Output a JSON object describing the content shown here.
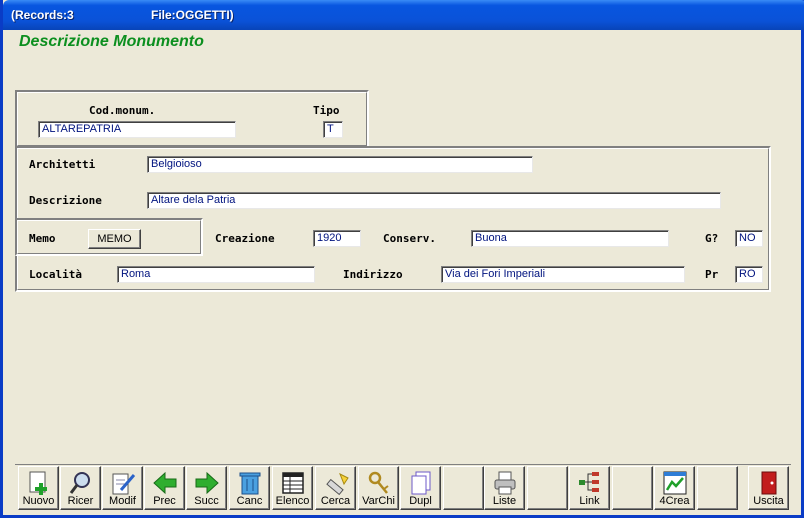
{
  "window": {
    "records": "(Records:3",
    "file": "File:OGGETTI)"
  },
  "form_title": "Descrizione Monumento",
  "fields": {
    "cod_monum": {
      "label": "Cod.monum.",
      "value": "ALTAREPATRIA"
    },
    "tipo": {
      "label": "Tipo",
      "value": "T"
    },
    "architetti": {
      "label": "Architetti",
      "value": "Belgioioso"
    },
    "descrizione": {
      "label": "Descrizione",
      "value": "Altare dela Patria"
    },
    "memo": {
      "label": "Memo",
      "button": "MEMO"
    },
    "creazione": {
      "label": "Creazione",
      "value": "1920"
    },
    "conserv": {
      "label": "Conserv.",
      "value": "Buona"
    },
    "g": {
      "label": "G?",
      "value": "NO"
    },
    "localita": {
      "label": "Località",
      "value": "Roma"
    },
    "indirizzo": {
      "label": "Indirizzo",
      "value": "Via dei Fori Imperiali"
    },
    "pr": {
      "label": "Pr",
      "value": "RO"
    }
  },
  "toolbar": {
    "nuovo": "Nuovo",
    "ricer": "Ricer",
    "modif": "Modif",
    "prec": "Prec",
    "succ": "Succ",
    "canc": "Canc",
    "elenco": "Elenco",
    "cerca": "Cerca",
    "varchi": "VarChi",
    "dupl": "Dupl",
    "liste": "Liste",
    "link": "Link",
    "crea": "4Crea",
    "uscita": "Uscita"
  },
  "colors": {
    "title_bar": "#0a52d8",
    "form_title": "#0c8f1f",
    "field_text": "#00137f",
    "background": "#ece9d8"
  }
}
